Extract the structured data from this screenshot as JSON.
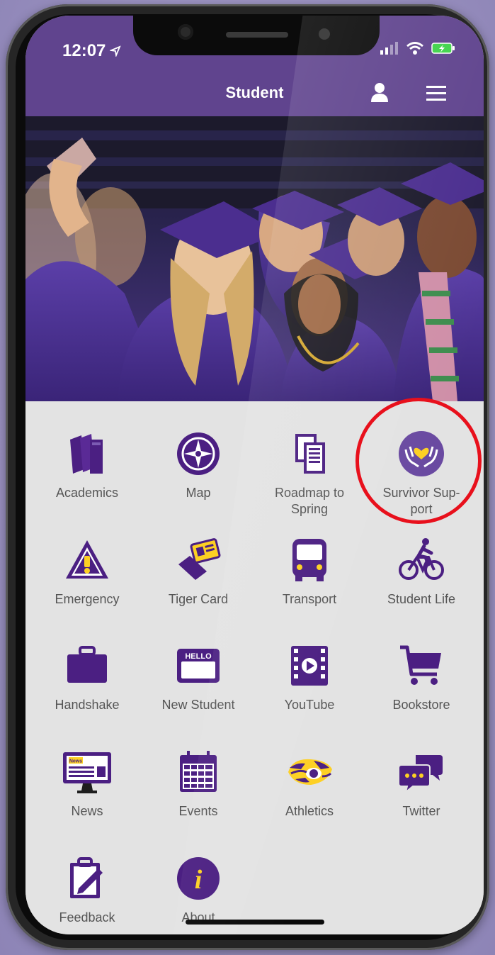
{
  "status_bar": {
    "time": "12:07"
  },
  "header": {
    "title": "Student"
  },
  "tiles": [
    {
      "label": "Academics",
      "icon": "books-icon"
    },
    {
      "label": "Map",
      "icon": "compass-icon"
    },
    {
      "label": "Roadmap to Spring",
      "icon": "documents-icon"
    },
    {
      "label": "Survivor Sup-port",
      "icon": "heart-hands-icon"
    },
    {
      "label": "Emergency",
      "icon": "warning-icon"
    },
    {
      "label": "Tiger Card",
      "icon": "id-card-icon"
    },
    {
      "label": "Transport",
      "icon": "bus-icon"
    },
    {
      "label": "Student Life",
      "icon": "cyclist-icon"
    },
    {
      "label": "Handshake",
      "icon": "briefcase-icon"
    },
    {
      "label": "New Student",
      "icon": "hello-badge-icon"
    },
    {
      "label": "YouTube",
      "icon": "video-icon"
    },
    {
      "label": "Bookstore",
      "icon": "cart-icon"
    },
    {
      "label": "News",
      "icon": "news-monitor-icon"
    },
    {
      "label": "Events",
      "icon": "calendar-icon"
    },
    {
      "label": "Athletics",
      "icon": "tiger-eye-icon"
    },
    {
      "label": "Twitter",
      "icon": "chat-bubbles-icon"
    },
    {
      "label": "Feedback",
      "icon": "clipboard-edit-icon"
    },
    {
      "label": "About",
      "icon": "info-icon"
    }
  ],
  "colors": {
    "brand_purple": "#461d7c",
    "header": "#60448e",
    "accent_gold": "#fdd023",
    "highlight_ring": "#e8101c"
  }
}
